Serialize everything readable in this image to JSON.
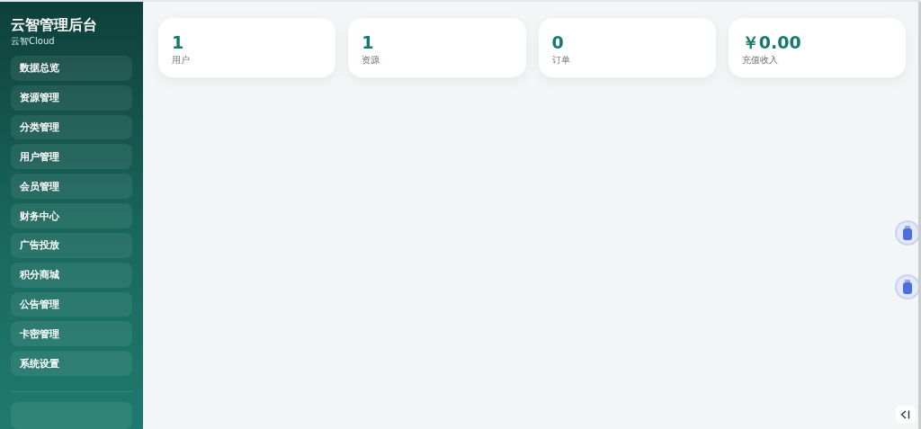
{
  "sidebar": {
    "title": "云智管理后台",
    "subtitle": "云智Cloud",
    "items": [
      {
        "label": "数据总览",
        "selected": false
      },
      {
        "label": "资源管理",
        "selected": false
      },
      {
        "label": "分类管理",
        "selected": false
      },
      {
        "label": "用户管理",
        "selected": false
      },
      {
        "label": "会员管理",
        "selected": false
      },
      {
        "label": "财务中心",
        "selected": false
      },
      {
        "label": "广告投放",
        "selected": false
      },
      {
        "label": "积分商城",
        "selected": false
      },
      {
        "label": "公告管理",
        "selected": false
      },
      {
        "label": "卡密管理",
        "selected": false
      },
      {
        "label": "系统设置",
        "selected": false
      }
    ]
  },
  "stats": [
    {
      "value": "1",
      "label": "用户"
    },
    {
      "value": "1",
      "label": "资源"
    },
    {
      "value": "0",
      "label": "订单"
    },
    {
      "value": "￥0.00",
      "label": "充值收入"
    }
  ]
}
